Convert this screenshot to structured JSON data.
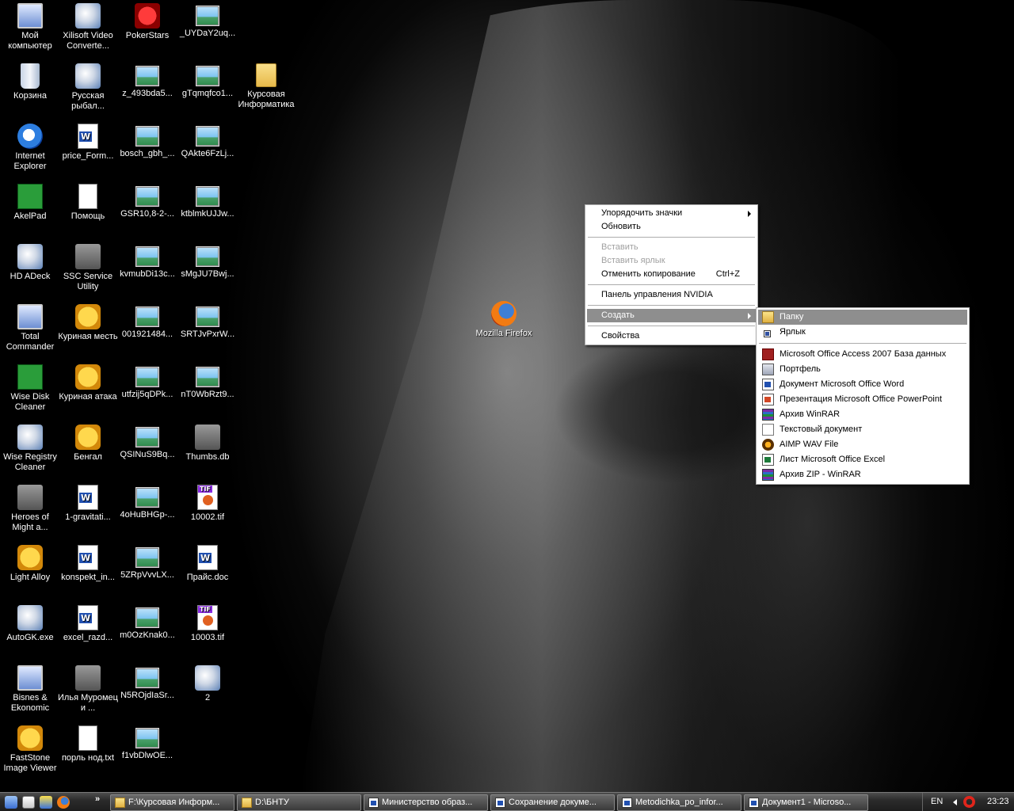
{
  "desktop": {
    "icons": [
      {
        "label": "Мой компьютер",
        "icon": "computer-icon"
      },
      {
        "label": "Xilisoft Video Converte...",
        "icon": "video-converter-icon"
      },
      {
        "label": "PokerStars",
        "icon": "pokerstars-icon"
      },
      {
        "label": "_UYDaY2uq...",
        "icon": "image-file-icon"
      },
      {
        "label": "Корзина",
        "icon": "recycle-bin-icon"
      },
      {
        "label": "Русская рыбал...",
        "icon": "fishing-game-icon"
      },
      {
        "label": "z_493bda5...",
        "icon": "image-file-icon"
      },
      {
        "label": "gTqmqfco1...",
        "icon": "image-file-icon"
      },
      {
        "label": "Курсовая Информатика",
        "icon": "folder-icon"
      },
      {
        "label": "Internet Explorer",
        "icon": "internet-explorer-icon"
      },
      {
        "label": "price_Form...",
        "icon": "word-document-icon"
      },
      {
        "label": "bosch_gbh_...",
        "icon": "image-file-icon"
      },
      {
        "label": "QAkte6FzLj...",
        "icon": "image-file-icon"
      },
      {
        "label": "AkelPad",
        "icon": "akelpad-icon"
      },
      {
        "label": "Помощь",
        "icon": "help-icon"
      },
      {
        "label": "GSR10,8-2-...",
        "icon": "image-file-icon"
      },
      {
        "label": "ktblmkUJJw...",
        "icon": "image-file-icon"
      },
      {
        "label": "HD ADeck",
        "icon": "hd-adeck-icon"
      },
      {
        "label": "SSC Service Utility",
        "icon": "printer-icon"
      },
      {
        "label": "kvmubDi13c...",
        "icon": "image-file-icon"
      },
      {
        "label": "sMgJU7Bwj...",
        "icon": "image-file-icon"
      },
      {
        "label": "Total Commander",
        "icon": "total-commander-icon"
      },
      {
        "label": "Куриная месть",
        "icon": "chicken-game-icon"
      },
      {
        "label": "001921484...",
        "icon": "image-file-icon"
      },
      {
        "label": "SRTJvPxrW...",
        "icon": "image-file-icon"
      },
      {
        "label": "Wise Disk Cleaner",
        "icon": "wise-disk-cleaner-icon"
      },
      {
        "label": "Куриная атака",
        "icon": "chicken-game-icon"
      },
      {
        "label": "utfzij5qDPk...",
        "icon": "image-file-icon"
      },
      {
        "label": "nT0WbRzt9...",
        "icon": "image-file-icon"
      },
      {
        "label": "Wise Registry Cleaner",
        "icon": "wise-registry-cleaner-icon"
      },
      {
        "label": "Бенгал",
        "icon": "bengal-game-icon"
      },
      {
        "label": "QSINuS9Bq...",
        "icon": "image-file-icon"
      },
      {
        "label": "Thumbs.db",
        "icon": "system-file-icon"
      },
      {
        "label": "Heroes of Might a...",
        "icon": "heroes-game-icon"
      },
      {
        "label": "1-gravitati...",
        "icon": "word-document-icon"
      },
      {
        "label": "4oHuBHGp-...",
        "icon": "image-file-icon"
      },
      {
        "label": "10002.tif",
        "icon": "tif-file-icon"
      },
      {
        "label": "Light Alloy",
        "icon": "light-alloy-icon"
      },
      {
        "label": "konspekt_in...",
        "icon": "word-document-icon"
      },
      {
        "label": "5ZRpVvvLX...",
        "icon": "image-file-icon"
      },
      {
        "label": "Прайс.doc",
        "icon": "word-document-icon"
      },
      {
        "label": "AutoGK.exe",
        "icon": "autogk-icon"
      },
      {
        "label": "excel_razd...",
        "icon": "word-document-icon"
      },
      {
        "label": "m0OzKnak0...",
        "icon": "image-file-icon"
      },
      {
        "label": "10003.tif",
        "icon": "tif-file-icon"
      },
      {
        "label": "Bisnes & Ekonomic",
        "icon": "bisnes-icon"
      },
      {
        "label": "Илья Муромец и ...",
        "icon": "ilya-muromets-icon"
      },
      {
        "label": "N5ROjdIaSr...",
        "icon": "image-file-icon"
      },
      {
        "label": "2",
        "icon": "stack-files-icon"
      },
      {
        "label": "FastStone Image Viewer",
        "icon": "faststone-icon"
      },
      {
        "label": "порль нод.txt",
        "icon": "text-file-icon"
      },
      {
        "label": "f1vbDlwOE...",
        "icon": "image-file-icon"
      },
      {
        "label": "Mozilla Firefox",
        "icon": "firefox-icon"
      }
    ]
  },
  "context_menu": {
    "items": [
      {
        "label": "Упорядочить значки",
        "submenu": true
      },
      {
        "label": "Обновить"
      },
      {
        "label": "Вставить",
        "disabled": true
      },
      {
        "label": "Вставить ярлык",
        "disabled": true
      },
      {
        "label": "Отменить копирование",
        "shortcut": "Ctrl+Z"
      },
      {
        "label": "Панель управления NVIDIA"
      },
      {
        "label": "Создать",
        "submenu": true
      },
      {
        "label": "Свойства"
      }
    ]
  },
  "submenu": {
    "items": [
      {
        "label": "Папку",
        "icon": "folder-icon"
      },
      {
        "label": "Ярлык",
        "icon": "shortcut-icon"
      },
      {
        "label": "Microsoft Office Access 2007 База данных",
        "icon": "access-icon"
      },
      {
        "label": "Портфель",
        "icon": "briefcase-icon"
      },
      {
        "label": "Документ Microsoft Office Word",
        "icon": "word-icon"
      },
      {
        "label": "Презентация Microsoft Office PowerPoint",
        "icon": "powerpoint-icon"
      },
      {
        "label": "Архив WinRAR",
        "icon": "winrar-icon"
      },
      {
        "label": "Текстовый документ",
        "icon": "text-document-icon"
      },
      {
        "label": "AIMP WAV File",
        "icon": "aimp-icon"
      },
      {
        "label": "Лист Microsoft Office Excel",
        "icon": "excel-icon"
      },
      {
        "label": "Архив ZIP - WinRAR",
        "icon": "winrar-zip-icon"
      }
    ]
  },
  "taskbar": {
    "quick_launch_more": "»",
    "buttons": [
      {
        "label": "F:\\Курсовая Информ...",
        "icon": "folder-icon"
      },
      {
        "label": "D:\\БНТУ",
        "icon": "folder-icon"
      },
      {
        "label": "Министерство образ...",
        "icon": "word-icon"
      },
      {
        "label": "Сохранение докуме...",
        "icon": "word-icon"
      },
      {
        "label": "Metodichka_po_infor...",
        "icon": "word-icon"
      },
      {
        "label": "Документ1 - Microso...",
        "icon": "word-icon"
      }
    ],
    "tray": {
      "language": "EN",
      "clock": "23:23"
    }
  }
}
